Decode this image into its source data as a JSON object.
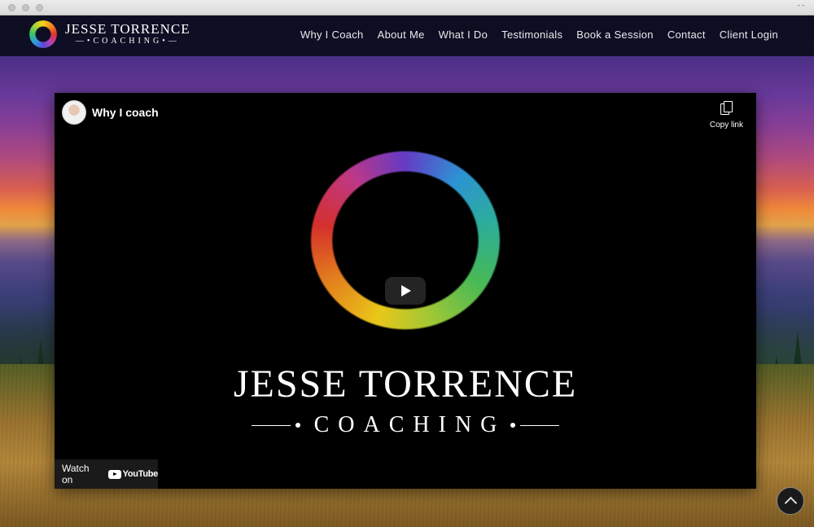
{
  "brand": {
    "title": "JESSE TORRENCE",
    "subtitle": "COACHING"
  },
  "nav": [
    {
      "label": "Why I Coach"
    },
    {
      "label": "About Me"
    },
    {
      "label": "What I Do"
    },
    {
      "label": "Testimonials"
    },
    {
      "label": "Book a Session"
    },
    {
      "label": "Contact"
    },
    {
      "label": "Client Login"
    }
  ],
  "video": {
    "title": "Why I coach",
    "copy_link_label": "Copy link",
    "logo_title": "JESSE TORRENCE",
    "logo_subtitle": "COACHING",
    "watch_on_label": "Watch on",
    "youtube_label": "YouTube"
  },
  "icons": {
    "logo": "rainbow-ring-icon",
    "copy": "copy-icon",
    "play": "play-icon",
    "youtube": "youtube-icon",
    "scroll_top": "chevron-up-icon"
  },
  "colors": {
    "header_bg": "#0a0c1c",
    "video_bg": "#000000",
    "text": "#ffffff"
  }
}
